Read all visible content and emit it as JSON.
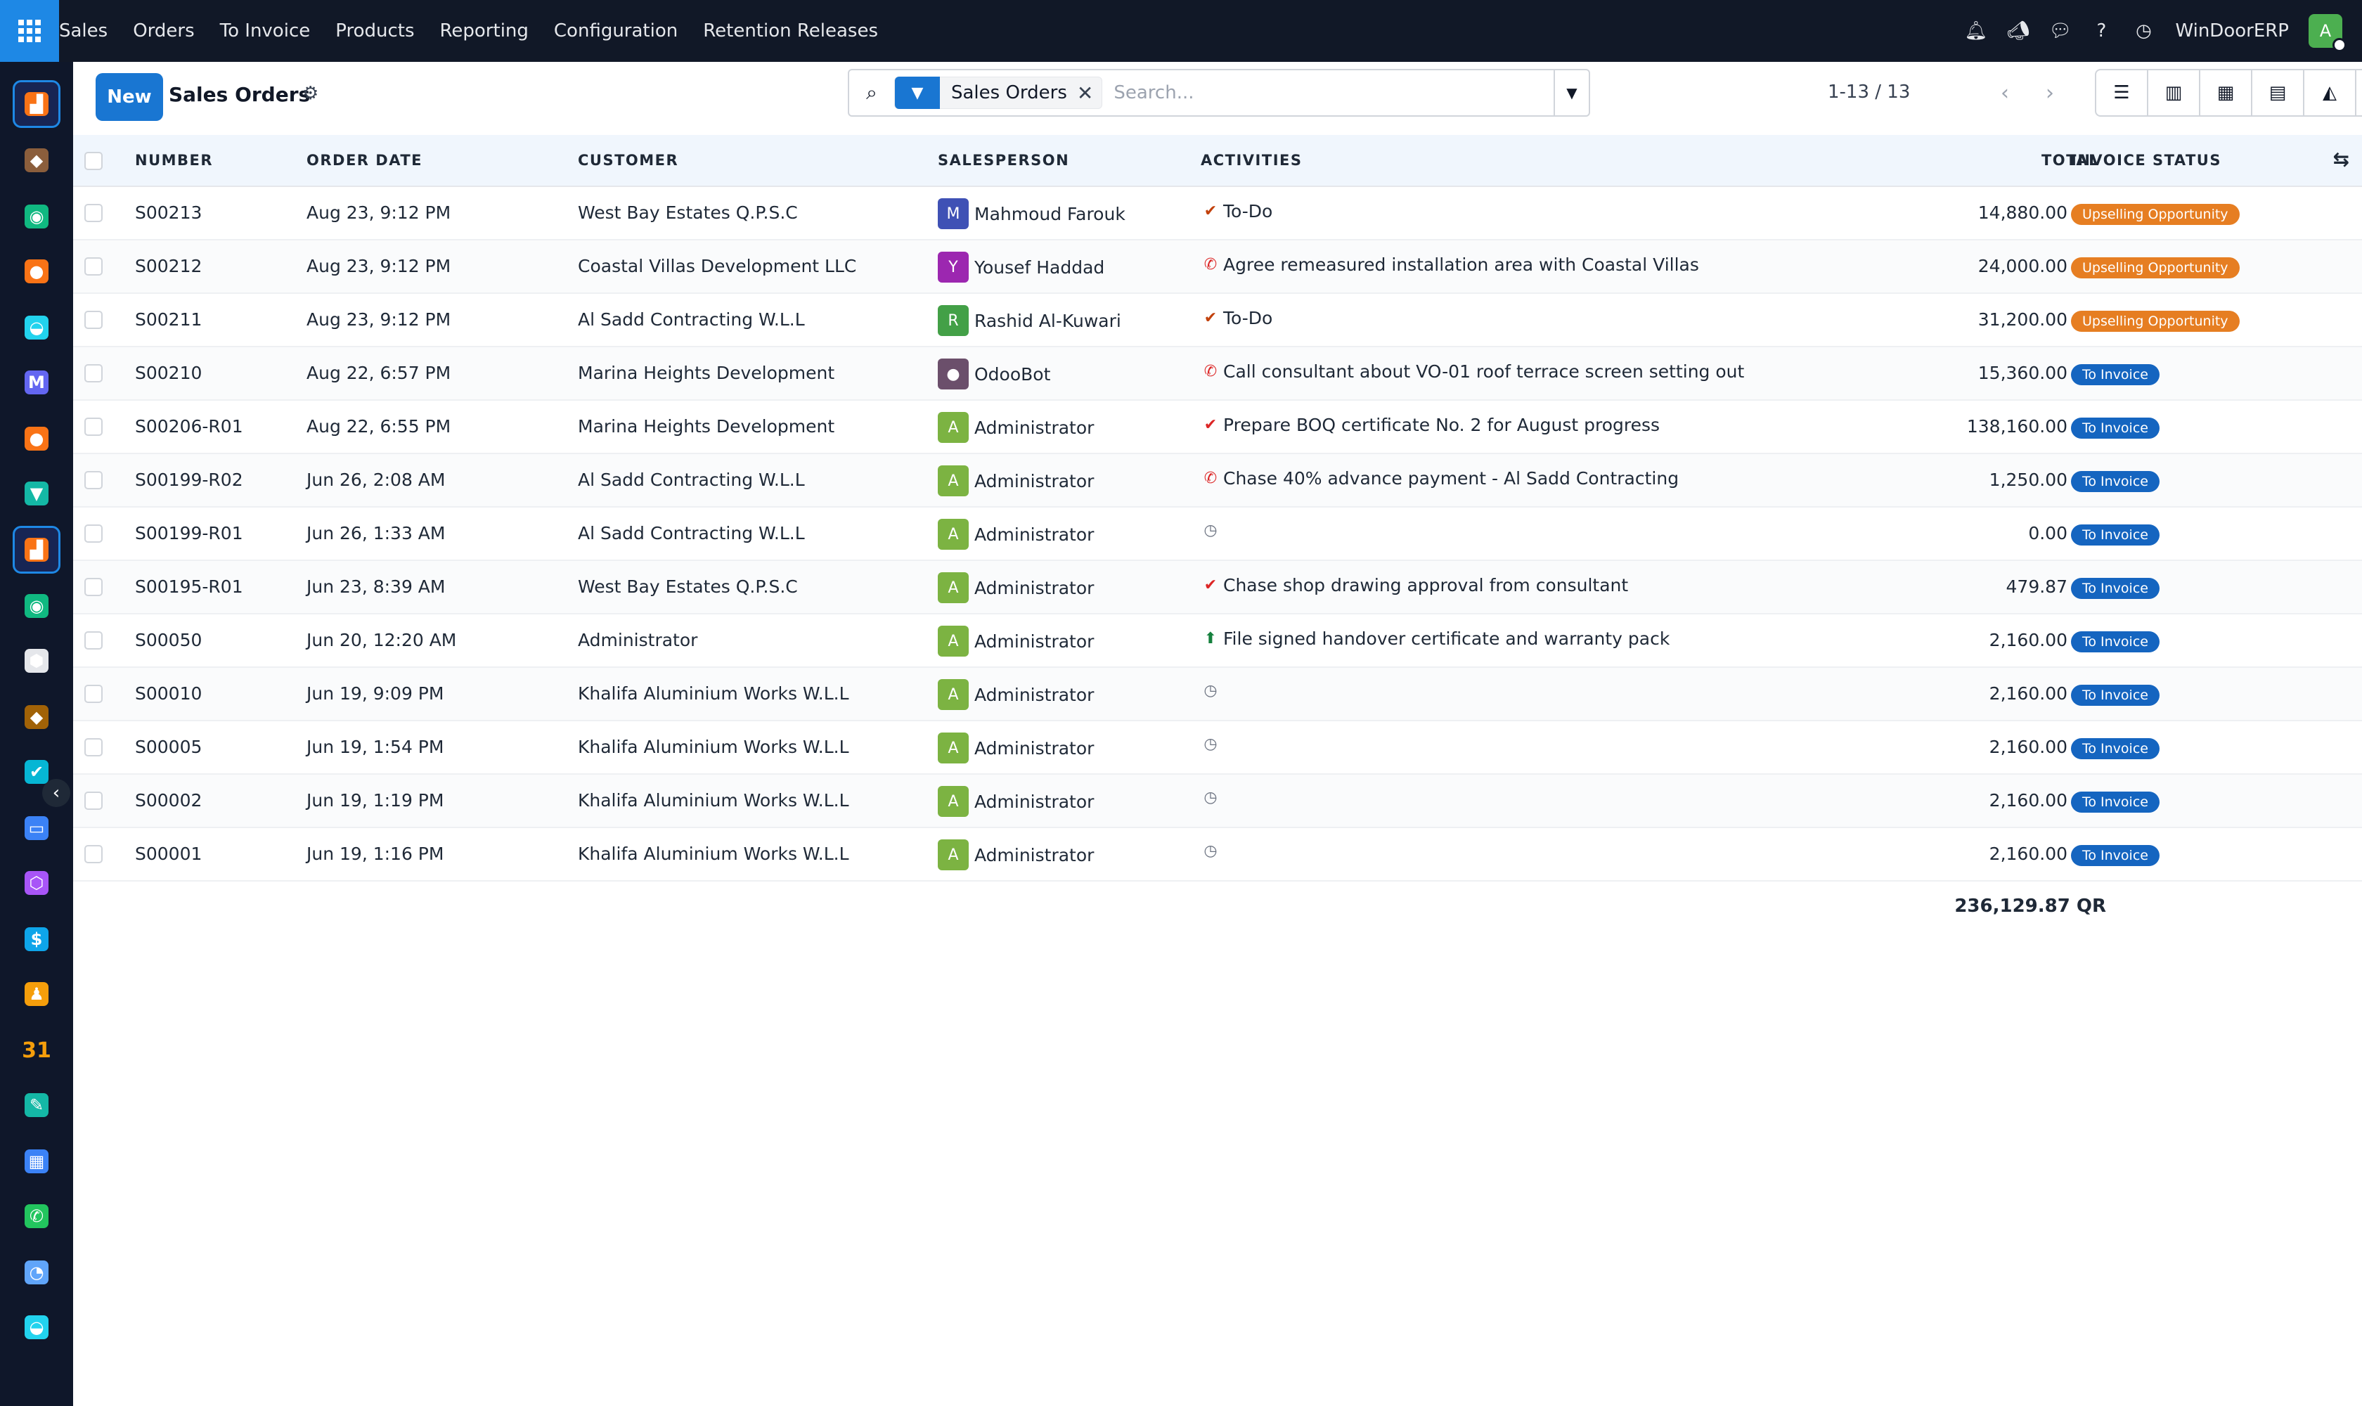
{
  "nav": {
    "menu": [
      "Sales",
      "Orders",
      "To Invoice",
      "Products",
      "Reporting",
      "Configuration",
      "Retention Releases"
    ],
    "icons": [
      "bell-icon",
      "megaphone-icon",
      "chat-icon",
      "help-icon",
      "clock-icon"
    ],
    "company": "WinDoorERP",
    "user_initial": "A"
  },
  "sidebar": {
    "apps": [
      {
        "icon": "sales-app-icon",
        "color": "#f97316",
        "glyph": "▟",
        "active": true
      },
      {
        "icon": "project-app-icon",
        "color": "#8b5e3c",
        "glyph": "◆"
      },
      {
        "icon": "contacts-app-icon",
        "color": "#10b981",
        "glyph": "◉"
      },
      {
        "icon": "discuss-app-icon",
        "color": "#f97316",
        "glyph": "●"
      },
      {
        "icon": "website-app-icon",
        "color": "#22d3ee",
        "glyph": "◒"
      },
      {
        "icon": "email-marketing-app-icon",
        "color": "#6366f1",
        "glyph": "M"
      },
      {
        "icon": "livechat-app-icon",
        "color": "#f97316",
        "glyph": "●"
      },
      {
        "icon": "accounting-app-icon",
        "color": "#14b8a6",
        "glyph": "▼"
      },
      {
        "icon": "sales-app-icon-2",
        "color": "#f97316",
        "glyph": "▟",
        "active": true
      },
      {
        "icon": "contacts-app-icon-2",
        "color": "#10b981",
        "glyph": "◉"
      },
      {
        "icon": "inventory-app-icon",
        "color": "#e5e7eb",
        "glyph": "⬢"
      },
      {
        "icon": "manufacturing-app-icon",
        "color": "#a16207",
        "glyph": "◆"
      },
      {
        "icon": "todo-app-icon",
        "color": "#06b6d4",
        "glyph": "✔"
      },
      {
        "icon": "knowledge-app-icon",
        "color": "#3b82f6",
        "glyph": "▭"
      },
      {
        "icon": "repair-app-icon",
        "color": "#a855f7",
        "glyph": "⬡"
      },
      {
        "icon": "expenses-app-icon",
        "color": "#0ea5e9",
        "glyph": "$"
      },
      {
        "icon": "employees-app-icon",
        "color": "#f59e0b",
        "glyph": "♟"
      },
      {
        "icon": "calendar-app-icon",
        "color": "#f59e0b",
        "glyph": "31"
      },
      {
        "icon": "sign-app-icon",
        "color": "#14b8a6",
        "glyph": "✎"
      },
      {
        "icon": "dashboards-app-icon",
        "color": "#3b82f6",
        "glyph": "▦"
      },
      {
        "icon": "whatsapp-app-icon",
        "color": "#22c55e",
        "glyph": "✆"
      },
      {
        "icon": "timesheet-app-icon",
        "color": "#60a5fa",
        "glyph": "◔"
      },
      {
        "icon": "website-app-icon-2",
        "color": "#22d3ee",
        "glyph": "◒"
      }
    ]
  },
  "control": {
    "new_label": "New",
    "title": "Sales Orders",
    "facet": "Sales Orders",
    "search_placeholder": "Search...",
    "pager": "1-13 / 13",
    "view_icons": [
      "list-view-icon",
      "kanban-view-icon",
      "calendar-view-icon",
      "pivot-view-icon",
      "graph-view-icon",
      "activity-view-icon"
    ]
  },
  "table": {
    "columns": [
      "NUMBER",
      "ORDER DATE",
      "CUSTOMER",
      "SALESPERSON",
      "ACTIVITIES",
      "TOTAL",
      "INVOICE STATUS"
    ],
    "rows": [
      {
        "number": "S00213",
        "date": "Aug 23, 9:12 PM",
        "customer": "West Bay Estates Q.P.S.C",
        "sp_initial": "M",
        "sp_color": "#3f51b5",
        "salesperson": "Mahmoud Farouk",
        "act_type": "check",
        "activity": "To-Do",
        "total": "14,880.00 QR",
        "status": "Upselling Opportunity"
      },
      {
        "number": "S00212",
        "date": "Aug 23, 9:12 PM",
        "customer": "Coastal Villas Development LLC",
        "sp_initial": "Y",
        "sp_color": "#9c27b0",
        "salesperson": "Yousef Haddad",
        "act_type": "phone",
        "activity": "Agree remeasured installation area with Coastal Villas",
        "total": "24,000.00 QR",
        "status": "Upselling Opportunity"
      },
      {
        "number": "S00211",
        "date": "Aug 23, 9:12 PM",
        "customer": "Al Sadd Contracting W.L.L",
        "sp_initial": "R",
        "sp_color": "#43a047",
        "salesperson": "Rashid Al-Kuwari",
        "act_type": "check",
        "activity": "To-Do",
        "total": "31,200.00 QR",
        "status": "Upselling Opportunity"
      },
      {
        "number": "S00210",
        "date": "Aug 22, 6:57 PM",
        "customer": "Marina Heights Development",
        "sp_initial": "●",
        "sp_color": "#6b4f6b",
        "salesperson": "OdooBot",
        "act_type": "phone",
        "activity": "Call consultant about VO-01 roof terrace screen setting out",
        "total": "15,360.00 QR",
        "status": "To Invoice"
      },
      {
        "number": "S00206-R01",
        "date": "Aug 22, 6:55 PM",
        "customer": "Marina Heights Development",
        "sp_initial": "A",
        "sp_color": "#7cb342",
        "salesperson": "Administrator",
        "act_type": "check-red",
        "activity": "Prepare BOQ certificate No. 2 for August progress",
        "total": "138,160.00 QR",
        "status": "To Invoice"
      },
      {
        "number": "S00199-R02",
        "date": "Jun 26, 2:08 AM",
        "customer": "Al Sadd Contracting W.L.L",
        "sp_initial": "A",
        "sp_color": "#7cb342",
        "salesperson": "Administrator",
        "act_type": "phone",
        "activity": "Chase 40% advance payment - Al Sadd Contracting",
        "total": "1,250.00 QR",
        "status": "To Invoice"
      },
      {
        "number": "S00199-R01",
        "date": "Jun 26, 1:33 AM",
        "customer": "Al Sadd Contracting W.L.L",
        "sp_initial": "A",
        "sp_color": "#7cb342",
        "salesperson": "Administrator",
        "act_type": "clock",
        "activity": "",
        "total": "0.00 QR",
        "status": "To Invoice"
      },
      {
        "number": "S00195-R01",
        "date": "Jun 23, 8:39 AM",
        "customer": "West Bay Estates Q.P.S.C",
        "sp_initial": "A",
        "sp_color": "#7cb342",
        "salesperson": "Administrator",
        "act_type": "check-red",
        "activity": "Chase shop drawing approval from consultant",
        "total": "479.87 QR",
        "status": "To Invoice"
      },
      {
        "number": "S00050",
        "date": "Jun 20, 12:20 AM",
        "customer": "Administrator",
        "sp_initial": "A",
        "sp_color": "#7cb342",
        "salesperson": "Administrator",
        "act_type": "upload",
        "activity": "File signed handover certificate and warranty pack",
        "total": "2,160.00 QR",
        "status": "To Invoice"
      },
      {
        "number": "S00010",
        "date": "Jun 19, 9:09 PM",
        "customer": "Khalifa Aluminium Works W.L.L",
        "sp_initial": "A",
        "sp_color": "#7cb342",
        "salesperson": "Administrator",
        "act_type": "clock",
        "activity": "",
        "total": "2,160.00 QR",
        "status": "To Invoice"
      },
      {
        "number": "S00005",
        "date": "Jun 19, 1:54 PM",
        "customer": "Khalifa Aluminium Works W.L.L",
        "sp_initial": "A",
        "sp_color": "#7cb342",
        "salesperson": "Administrator",
        "act_type": "clock",
        "activity": "",
        "total": "2,160.00 QR",
        "status": "To Invoice"
      },
      {
        "number": "S00002",
        "date": "Jun 19, 1:19 PM",
        "customer": "Khalifa Aluminium Works W.L.L",
        "sp_initial": "A",
        "sp_color": "#7cb342",
        "salesperson": "Administrator",
        "act_type": "clock",
        "activity": "",
        "total": "2,160.00 QR",
        "status": "To Invoice"
      },
      {
        "number": "S00001",
        "date": "Jun 19, 1:16 PM",
        "customer": "Khalifa Aluminium Works W.L.L",
        "sp_initial": "A",
        "sp_color": "#7cb342",
        "salesperson": "Administrator",
        "act_type": "clock",
        "activity": "",
        "total": "2,160.00 QR",
        "status": "To Invoice"
      }
    ],
    "grand_total": "236,129.87 QR"
  },
  "colors": {
    "upsell": "#e67e22",
    "to_invoice": "#1565c0",
    "check": "#c2410c",
    "check_red": "#dc2626",
    "phone": "#dc2626",
    "upload": "#15803d",
    "clock": "#6b7280"
  }
}
